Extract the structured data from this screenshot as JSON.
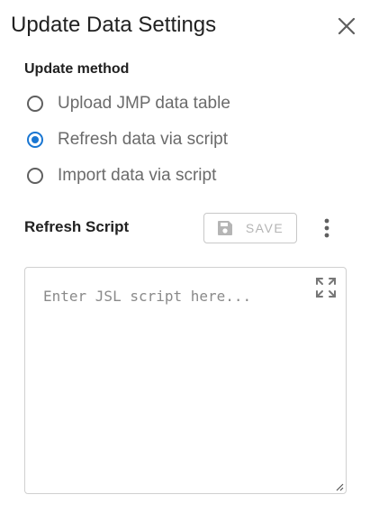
{
  "dialog": {
    "title": "Update Data Settings",
    "close_icon": "close-icon"
  },
  "update_method": {
    "label": "Update method",
    "options": [
      {
        "label": "Upload JMP data table",
        "selected": false
      },
      {
        "label": "Refresh data via script",
        "selected": true
      },
      {
        "label": "Import data via script",
        "selected": false
      }
    ]
  },
  "refresh_script": {
    "label": "Refresh Script",
    "save_label": "SAVE",
    "save_icon": "save-icon",
    "more_icon": "more-vert-icon",
    "placeholder": "Enter JSL script here...",
    "value": "",
    "expand_icon": "expand-icon"
  },
  "colors": {
    "accent": "#1976d2",
    "text_primary": "#212121",
    "text_secondary": "#6b6b6b",
    "disabled": "#b5b5b5"
  }
}
